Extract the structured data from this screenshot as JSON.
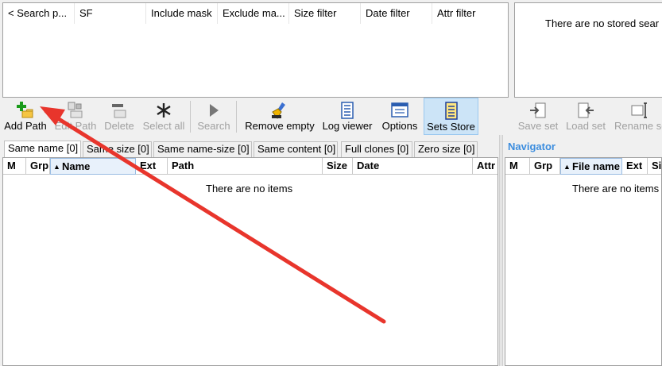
{
  "search_list": {
    "columns": [
      "< Search p...",
      "SF",
      "Include mask",
      "Exclude ma...",
      "Size filter",
      "Date filter",
      "Attr filter"
    ]
  },
  "stored_sets": {
    "empty_text": "There are no stored sear"
  },
  "toolbar": {
    "add_path": "Add Path",
    "edit_path": "Edit Path",
    "delete": "Delete",
    "select_all": "Select all",
    "search": "Search",
    "remove_empty": "Remove empty",
    "log_viewer": "Log viewer",
    "options": "Options",
    "sets_store": "Sets Store"
  },
  "set_toolbar": {
    "save_set": "Save set",
    "load_set": "Load set",
    "rename_set": "Rename se"
  },
  "tabs": [
    "Same name [0]",
    "Same size [0]",
    "Same name-size [0]",
    "Same content [0]",
    "Full clones [0]",
    "Zero size [0]"
  ],
  "results_grid": {
    "columns": [
      "M",
      "Grp",
      "Name",
      "Ext",
      "Path",
      "Size",
      "Date",
      "Attr"
    ],
    "empty_text": "There are no items"
  },
  "navigator": {
    "title": "Navigator",
    "columns": [
      "M",
      "Grp",
      "File name",
      "Ext",
      "Si"
    ],
    "empty_text": "There are no items"
  },
  "colors": {
    "annotation_arrow": "#e8352c",
    "navigator_title": "#3c8dde",
    "active_button": "#cce4f7"
  }
}
